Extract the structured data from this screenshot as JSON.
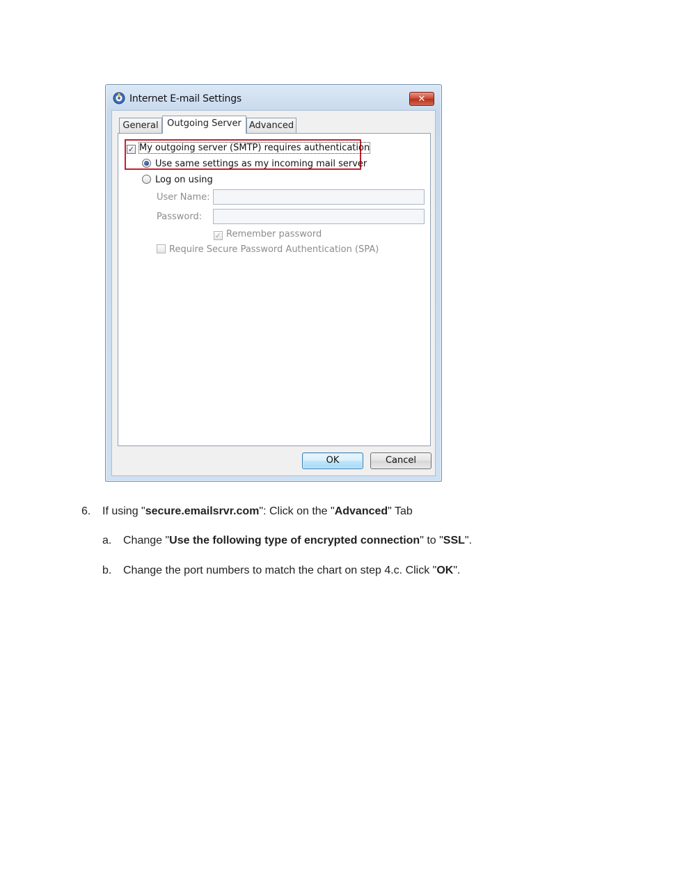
{
  "dialog": {
    "title": "Internet E-mail Settings",
    "close_label": "✕",
    "tabs": [
      "General",
      "Outgoing Server",
      "Advanced"
    ],
    "smtp_auth_label": "My outgoing server (SMTP) requires authentication",
    "smtp_auth_checked": true,
    "same_settings_label": "Use same settings as my incoming mail server",
    "logon_label": "Log on using",
    "username_label": "User Name:",
    "username_value": "",
    "password_label": "Password:",
    "password_value": "",
    "remember_label": "Remember password",
    "spa_label": "Require Secure Password Authentication (SPA)",
    "ok_label": "OK",
    "cancel_label": "Cancel"
  },
  "instructions": [
    {
      "marker": "6.",
      "parts": [
        {
          "t": "If using \"",
          "b": false
        },
        {
          "t": "secure.emailsrvr.com",
          "b": true
        },
        {
          "t": "\": Click on the \"",
          "b": false
        },
        {
          "t": "Advanced",
          "b": true
        },
        {
          "t": "\" Tab",
          "b": false
        }
      ]
    },
    {
      "marker": "a.",
      "parts": [
        {
          "t": "Change \"",
          "b": false
        },
        {
          "t": "Use the following type of encrypted connection",
          "b": true
        },
        {
          "t": "\" to \"",
          "b": false
        },
        {
          "t": "SSL",
          "b": true
        },
        {
          "t": "\".",
          "b": false
        }
      ]
    },
    {
      "marker": "b.",
      "parts": [
        {
          "t": "Change the port numbers to match the chart on step 4.c. Click \"",
          "b": false
        },
        {
          "t": "OK",
          "b": true
        },
        {
          "t": "\".",
          "b": false
        }
      ]
    }
  ]
}
